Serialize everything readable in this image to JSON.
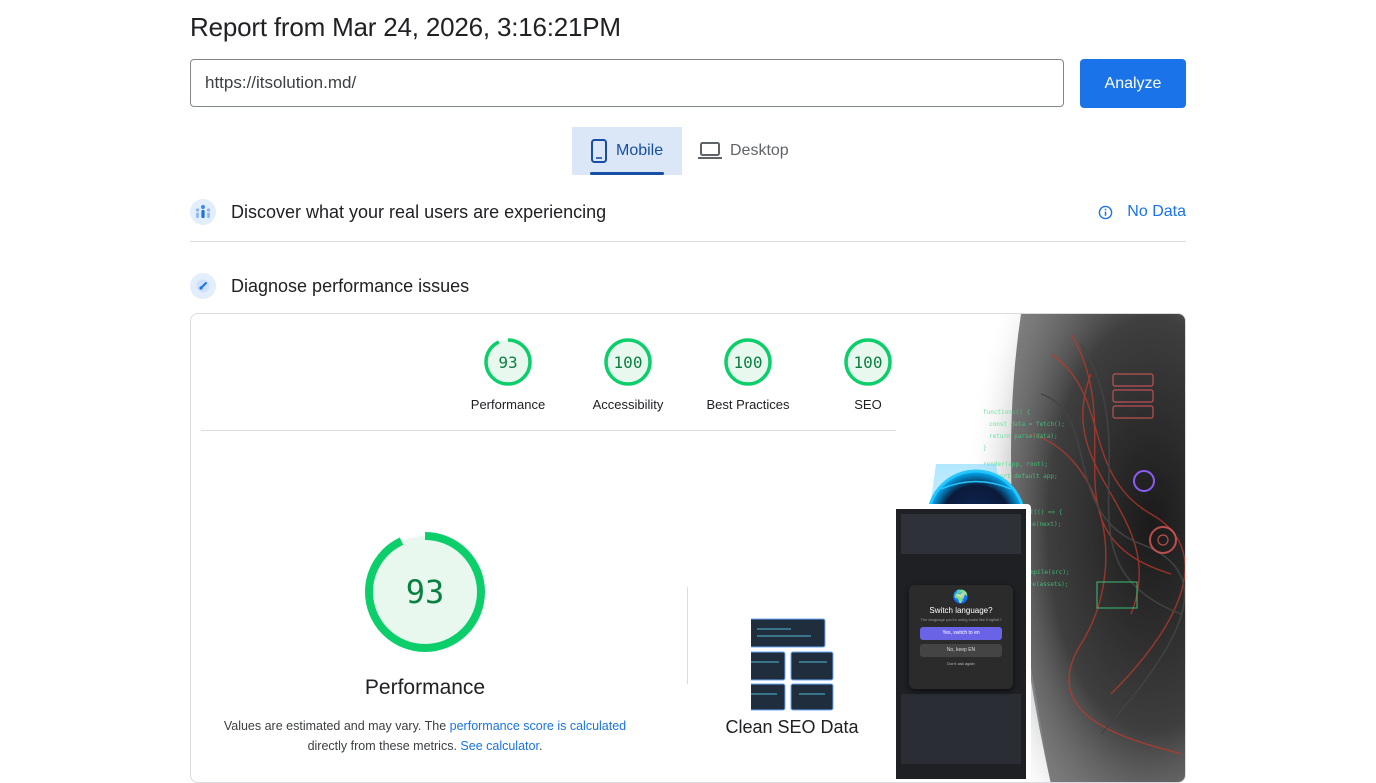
{
  "header": {
    "title": "Report from Mar 24, 2026, 3:16:21PM"
  },
  "search": {
    "url_value": "https://itsolution.md/",
    "analyze_label": "Analyze"
  },
  "device_tabs": [
    {
      "label": "Mobile",
      "selected": true,
      "icon": "phone-icon"
    },
    {
      "label": "Desktop",
      "selected": false,
      "icon": "laptop-icon"
    }
  ],
  "field_section": {
    "title": "Discover what your real users are experiencing",
    "status": "No Data",
    "icon": "users-icon",
    "status_icon": "info-icon"
  },
  "lab_section": {
    "title": "Diagnose performance issues",
    "icon": "gauge-icon"
  },
  "scores": [
    {
      "label": "Performance",
      "value": "93",
      "fraction": 0.93
    },
    {
      "label": "Accessibility",
      "value": "100",
      "fraction": 1.0
    },
    {
      "label": "Best Practices",
      "value": "100",
      "fraction": 1.0
    },
    {
      "label": "SEO",
      "value": "100",
      "fraction": 1.0
    }
  ],
  "performance": {
    "score": "93",
    "fraction": 0.93,
    "label": "Performance",
    "note_prefix": "Values are estimated and may vary. The ",
    "note_link1": "performance score is calculated",
    "note_mid": "directly from these metrics. ",
    "note_link2": "See calculator",
    "note_suffix": "."
  },
  "screenshot_art": {
    "caption": "Clean SEO Data",
    "dialog_title": "Switch language?",
    "dialog_sub": "The language you're using looks like English?",
    "dialog_btn_primary": "Yes, switch to en",
    "dialog_btn_secondary": "No, keep EN",
    "dialog_checkbox": "Don't ask again"
  },
  "colors": {
    "accent": "#1a73e8",
    "score_good": "#0cce6b",
    "score_text": "#0b8043",
    "tab_selected_bg": "#dbe7f7"
  }
}
